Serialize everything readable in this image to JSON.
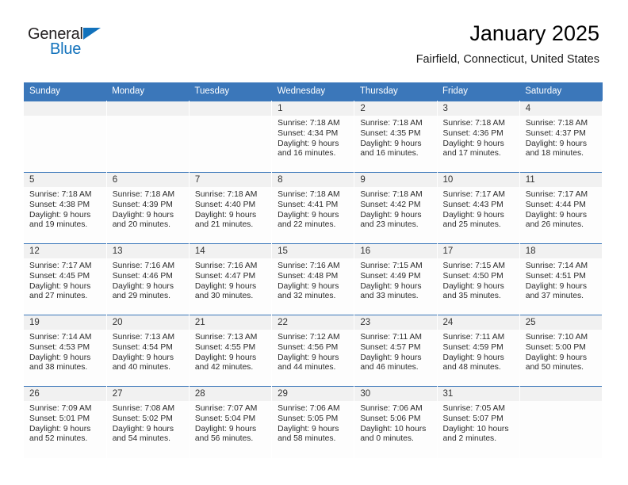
{
  "brand": {
    "name_part1": "General",
    "name_part2": "Blue",
    "triangle_icon": "triangle-icon",
    "accent_color": "#1272bc"
  },
  "header": {
    "title": "January 2025",
    "subtitle": "Fairfield, Connecticut, United States",
    "header_bg_color": "#3b77ba"
  },
  "weekdays": [
    {
      "label": "Sunday"
    },
    {
      "label": "Monday"
    },
    {
      "label": "Tuesday"
    },
    {
      "label": "Wednesday"
    },
    {
      "label": "Thursday"
    },
    {
      "label": "Friday"
    },
    {
      "label": "Saturday"
    }
  ],
  "weeks": [
    {
      "days": [
        {
          "day": "",
          "sunrise": "",
          "sunset": "",
          "daylight_line1": "",
          "daylight_line2": "",
          "empty": true
        },
        {
          "day": "",
          "sunrise": "",
          "sunset": "",
          "daylight_line1": "",
          "daylight_line2": "",
          "empty": true
        },
        {
          "day": "",
          "sunrise": "",
          "sunset": "",
          "daylight_line1": "",
          "daylight_line2": "",
          "empty": true
        },
        {
          "day": "1",
          "sunrise": "Sunrise: 7:18 AM",
          "sunset": "Sunset: 4:34 PM",
          "daylight_line1": "Daylight: 9 hours",
          "daylight_line2": "and 16 minutes."
        },
        {
          "day": "2",
          "sunrise": "Sunrise: 7:18 AM",
          "sunset": "Sunset: 4:35 PM",
          "daylight_line1": "Daylight: 9 hours",
          "daylight_line2": "and 16 minutes."
        },
        {
          "day": "3",
          "sunrise": "Sunrise: 7:18 AM",
          "sunset": "Sunset: 4:36 PM",
          "daylight_line1": "Daylight: 9 hours",
          "daylight_line2": "and 17 minutes."
        },
        {
          "day": "4",
          "sunrise": "Sunrise: 7:18 AM",
          "sunset": "Sunset: 4:37 PM",
          "daylight_line1": "Daylight: 9 hours",
          "daylight_line2": "and 18 minutes."
        }
      ]
    },
    {
      "days": [
        {
          "day": "5",
          "sunrise": "Sunrise: 7:18 AM",
          "sunset": "Sunset: 4:38 PM",
          "daylight_line1": "Daylight: 9 hours",
          "daylight_line2": "and 19 minutes."
        },
        {
          "day": "6",
          "sunrise": "Sunrise: 7:18 AM",
          "sunset": "Sunset: 4:39 PM",
          "daylight_line1": "Daylight: 9 hours",
          "daylight_line2": "and 20 minutes."
        },
        {
          "day": "7",
          "sunrise": "Sunrise: 7:18 AM",
          "sunset": "Sunset: 4:40 PM",
          "daylight_line1": "Daylight: 9 hours",
          "daylight_line2": "and 21 minutes."
        },
        {
          "day": "8",
          "sunrise": "Sunrise: 7:18 AM",
          "sunset": "Sunset: 4:41 PM",
          "daylight_line1": "Daylight: 9 hours",
          "daylight_line2": "and 22 minutes."
        },
        {
          "day": "9",
          "sunrise": "Sunrise: 7:18 AM",
          "sunset": "Sunset: 4:42 PM",
          "daylight_line1": "Daylight: 9 hours",
          "daylight_line2": "and 23 minutes."
        },
        {
          "day": "10",
          "sunrise": "Sunrise: 7:17 AM",
          "sunset": "Sunset: 4:43 PM",
          "daylight_line1": "Daylight: 9 hours",
          "daylight_line2": "and 25 minutes."
        },
        {
          "day": "11",
          "sunrise": "Sunrise: 7:17 AM",
          "sunset": "Sunset: 4:44 PM",
          "daylight_line1": "Daylight: 9 hours",
          "daylight_line2": "and 26 minutes."
        }
      ]
    },
    {
      "days": [
        {
          "day": "12",
          "sunrise": "Sunrise: 7:17 AM",
          "sunset": "Sunset: 4:45 PM",
          "daylight_line1": "Daylight: 9 hours",
          "daylight_line2": "and 27 minutes."
        },
        {
          "day": "13",
          "sunrise": "Sunrise: 7:16 AM",
          "sunset": "Sunset: 4:46 PM",
          "daylight_line1": "Daylight: 9 hours",
          "daylight_line2": "and 29 minutes."
        },
        {
          "day": "14",
          "sunrise": "Sunrise: 7:16 AM",
          "sunset": "Sunset: 4:47 PM",
          "daylight_line1": "Daylight: 9 hours",
          "daylight_line2": "and 30 minutes."
        },
        {
          "day": "15",
          "sunrise": "Sunrise: 7:16 AM",
          "sunset": "Sunset: 4:48 PM",
          "daylight_line1": "Daylight: 9 hours",
          "daylight_line2": "and 32 minutes."
        },
        {
          "day": "16",
          "sunrise": "Sunrise: 7:15 AM",
          "sunset": "Sunset: 4:49 PM",
          "daylight_line1": "Daylight: 9 hours",
          "daylight_line2": "and 33 minutes."
        },
        {
          "day": "17",
          "sunrise": "Sunrise: 7:15 AM",
          "sunset": "Sunset: 4:50 PM",
          "daylight_line1": "Daylight: 9 hours",
          "daylight_line2": "and 35 minutes."
        },
        {
          "day": "18",
          "sunrise": "Sunrise: 7:14 AM",
          "sunset": "Sunset: 4:51 PM",
          "daylight_line1": "Daylight: 9 hours",
          "daylight_line2": "and 37 minutes."
        }
      ]
    },
    {
      "days": [
        {
          "day": "19",
          "sunrise": "Sunrise: 7:14 AM",
          "sunset": "Sunset: 4:53 PM",
          "daylight_line1": "Daylight: 9 hours",
          "daylight_line2": "and 38 minutes."
        },
        {
          "day": "20",
          "sunrise": "Sunrise: 7:13 AM",
          "sunset": "Sunset: 4:54 PM",
          "daylight_line1": "Daylight: 9 hours",
          "daylight_line2": "and 40 minutes."
        },
        {
          "day": "21",
          "sunrise": "Sunrise: 7:13 AM",
          "sunset": "Sunset: 4:55 PM",
          "daylight_line1": "Daylight: 9 hours",
          "daylight_line2": "and 42 minutes."
        },
        {
          "day": "22",
          "sunrise": "Sunrise: 7:12 AM",
          "sunset": "Sunset: 4:56 PM",
          "daylight_line1": "Daylight: 9 hours",
          "daylight_line2": "and 44 minutes."
        },
        {
          "day": "23",
          "sunrise": "Sunrise: 7:11 AM",
          "sunset": "Sunset: 4:57 PM",
          "daylight_line1": "Daylight: 9 hours",
          "daylight_line2": "and 46 minutes."
        },
        {
          "day": "24",
          "sunrise": "Sunrise: 7:11 AM",
          "sunset": "Sunset: 4:59 PM",
          "daylight_line1": "Daylight: 9 hours",
          "daylight_line2": "and 48 minutes."
        },
        {
          "day": "25",
          "sunrise": "Sunrise: 7:10 AM",
          "sunset": "Sunset: 5:00 PM",
          "daylight_line1": "Daylight: 9 hours",
          "daylight_line2": "and 50 minutes."
        }
      ]
    },
    {
      "days": [
        {
          "day": "26",
          "sunrise": "Sunrise: 7:09 AM",
          "sunset": "Sunset: 5:01 PM",
          "daylight_line1": "Daylight: 9 hours",
          "daylight_line2": "and 52 minutes."
        },
        {
          "day": "27",
          "sunrise": "Sunrise: 7:08 AM",
          "sunset": "Sunset: 5:02 PM",
          "daylight_line1": "Daylight: 9 hours",
          "daylight_line2": "and 54 minutes."
        },
        {
          "day": "28",
          "sunrise": "Sunrise: 7:07 AM",
          "sunset": "Sunset: 5:04 PM",
          "daylight_line1": "Daylight: 9 hours",
          "daylight_line2": "and 56 minutes."
        },
        {
          "day": "29",
          "sunrise": "Sunrise: 7:06 AM",
          "sunset": "Sunset: 5:05 PM",
          "daylight_line1": "Daylight: 9 hours",
          "daylight_line2": "and 58 minutes."
        },
        {
          "day": "30",
          "sunrise": "Sunrise: 7:06 AM",
          "sunset": "Sunset: 5:06 PM",
          "daylight_line1": "Daylight: 10 hours",
          "daylight_line2": "and 0 minutes."
        },
        {
          "day": "31",
          "sunrise": "Sunrise: 7:05 AM",
          "sunset": "Sunset: 5:07 PM",
          "daylight_line1": "Daylight: 10 hours",
          "daylight_line2": "and 2 minutes."
        },
        {
          "day": "",
          "sunrise": "",
          "sunset": "",
          "daylight_line1": "",
          "daylight_line2": "",
          "empty": true
        }
      ]
    }
  ]
}
